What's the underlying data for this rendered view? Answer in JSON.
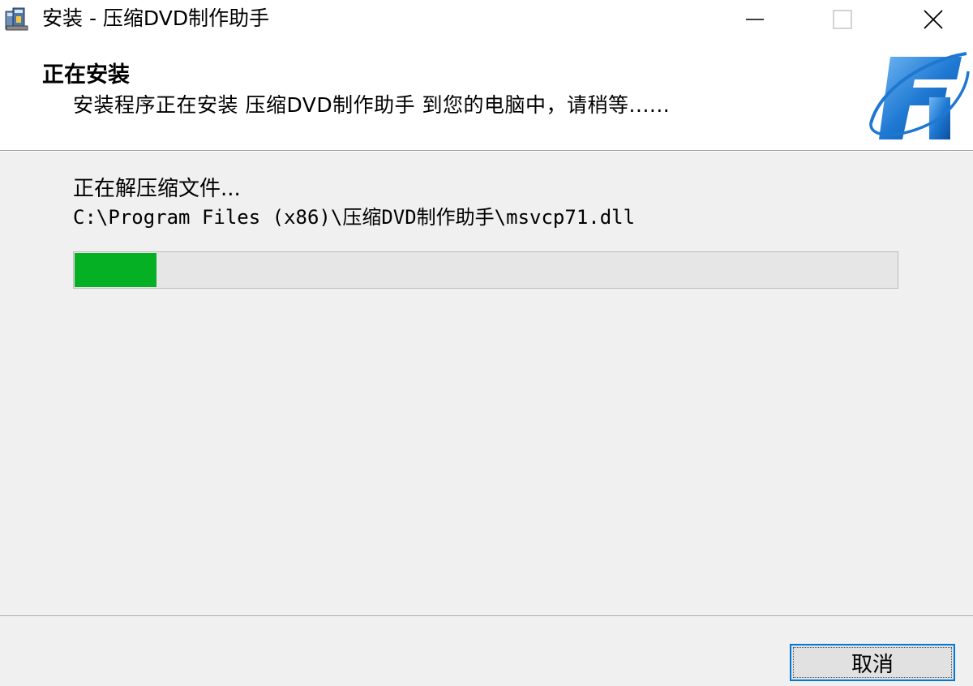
{
  "window": {
    "title": "安装 - 压缩DVD制作助手",
    "icon": "installer-icon",
    "controls": [
      "minimize-icon",
      "maximize-icon",
      "close-icon"
    ]
  },
  "header": {
    "title": "正在安装",
    "subtitle": "安装程序正在安装 压缩DVD制作助手 到您的电脑中，请稍等......",
    "logo": "app-logo"
  },
  "main": {
    "status": "正在解压缩文件...",
    "current_file": "C:\\Program Files (x86)\\压缩DVD制作助手\\msvcp71.dll",
    "progress_fraction": 0.1
  },
  "footer": {
    "cancel_label": "取消"
  },
  "colors": {
    "progress_fill": "#06b025",
    "progress_track": "#e6e6e6",
    "focus_border": "#0078d7",
    "logo_blue": "#1e78d2"
  }
}
